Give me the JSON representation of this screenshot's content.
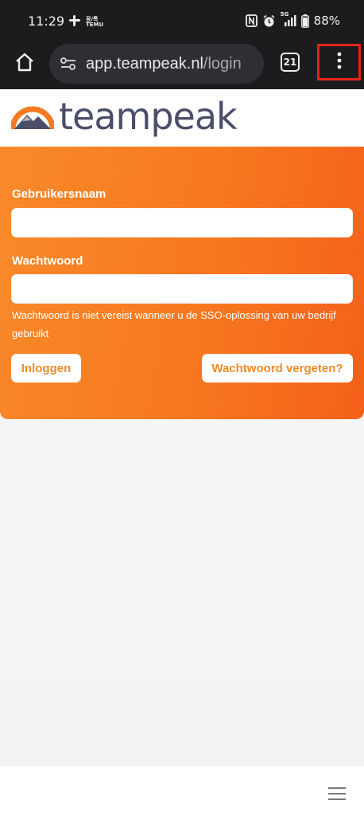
{
  "status_bar": {
    "time": "11:29",
    "left_icons": [
      "slack-icon",
      "temu-icon"
    ],
    "mini_label_top": "꿈/특",
    "mini_label_bottom": "TEMU",
    "network": "5G",
    "battery": "88%",
    "right_icons": [
      "nfc-icon",
      "alarm-icon",
      "signal-icon",
      "battery-icon"
    ]
  },
  "browser": {
    "url_host": "app.teampeak.nl",
    "url_path": "/login",
    "tab_count": "21",
    "icons": [
      "home-icon",
      "site-settings-icon",
      "more-vert-icon"
    ]
  },
  "logo": {
    "wordmark": "teampeak",
    "colors": {
      "orange": "#f47b20",
      "slate": "#4a4e69"
    }
  },
  "login": {
    "username_label": "Gebruikersnaam",
    "username_value": "",
    "password_label": "Wachtwoord",
    "password_value": "",
    "hint": "Wachtwoord is niet vereist wanneer u de SSO-oplossing van uw bedrijf gebruikt",
    "login_button": "Inloggen",
    "forgot_button": "Wachtwoord vergeten?",
    "accent": "#f7781f"
  },
  "bottom_bar": {
    "menu_icon": "hamburger-icon"
  }
}
